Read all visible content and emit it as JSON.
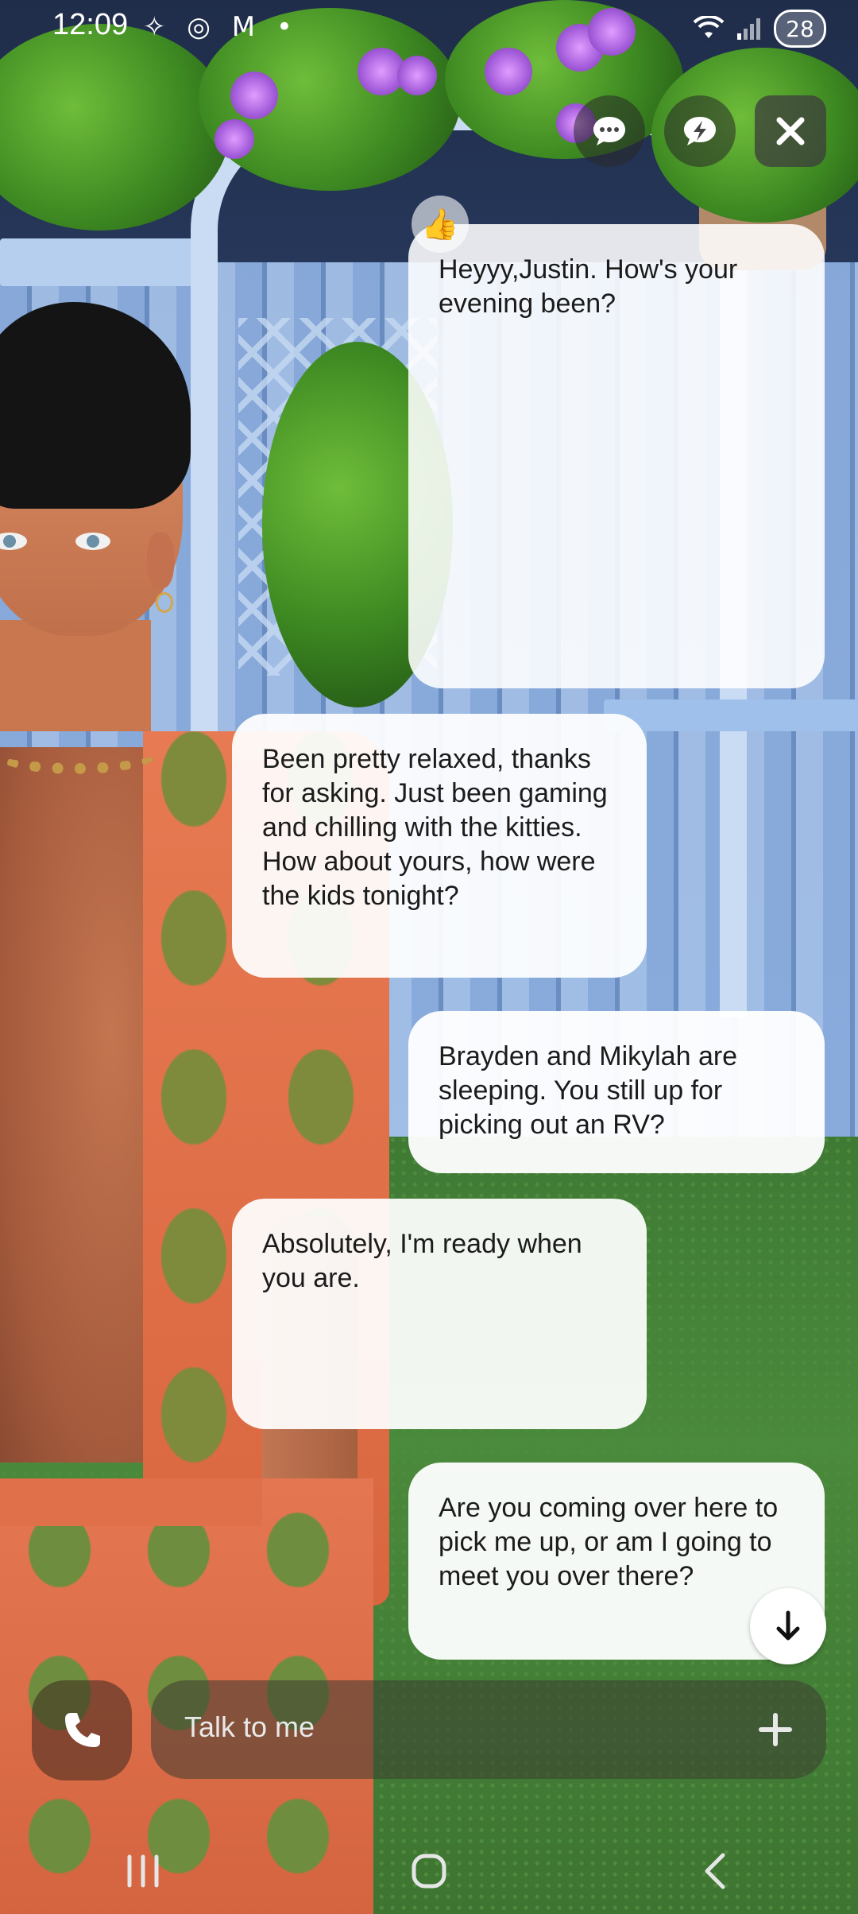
{
  "status_bar": {
    "time": "12:09",
    "left_icons": "✧ ◎ M •",
    "battery": "28"
  },
  "top_actions": [
    {
      "name": "chat-bubble-icon"
    },
    {
      "name": "lightning-bubble-icon"
    },
    {
      "name": "close-icon"
    }
  ],
  "messages": [
    {
      "sender": "other",
      "text": "Heyyy,Justin. How's your evening been?",
      "reaction": "👍"
    },
    {
      "sender": "me",
      "text": "Been pretty relaxed, thanks for asking. Just been gaming and chilling with the kitties. How about yours, how were the kids tonight?"
    },
    {
      "sender": "other",
      "text": "Brayden and Mikylah are sleeping. You still up for picking out an RV?"
    },
    {
      "sender": "me",
      "text": "Absolutely, I'm ready when you are."
    },
    {
      "sender": "other",
      "text": "Are you coming over here to pick me up, or am I going to meet you over there?"
    }
  ],
  "composer": {
    "placeholder": "Talk to me",
    "call_icon": "phone-icon",
    "add_icon": "plus-icon"
  },
  "nav": [
    "recents-icon",
    "home-icon",
    "back-icon"
  ]
}
